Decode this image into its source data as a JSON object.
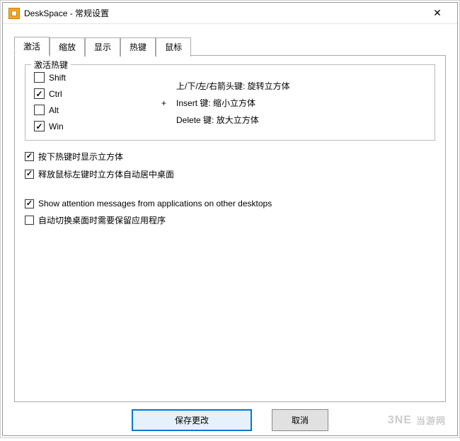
{
  "window": {
    "title": "DeskSpace - 常规设置",
    "close_label": "✕"
  },
  "tabs": {
    "items": [
      {
        "label": "激活",
        "active": true
      },
      {
        "label": "缩放",
        "active": false
      },
      {
        "label": "显示",
        "active": false
      },
      {
        "label": "热键",
        "active": false
      },
      {
        "label": "鼠标",
        "active": false
      }
    ]
  },
  "hotkey_group": {
    "legend": "激活热键",
    "modifiers": [
      {
        "key": "shift",
        "label": "Shift",
        "checked": false
      },
      {
        "key": "ctrl",
        "label": "Ctrl",
        "checked": true
      },
      {
        "key": "alt",
        "label": "Alt",
        "checked": false
      },
      {
        "key": "win",
        "label": "Win",
        "checked": true
      }
    ],
    "plus": "+",
    "hints": [
      "上/下/左/右箭头键: 旋转立方体",
      "Insert 键: 缩小立方体",
      "Delete 键: 放大立方体"
    ]
  },
  "options": [
    {
      "key": "show_cube_on_hotkey",
      "label": "按下热键时显示立方体",
      "checked": true
    },
    {
      "key": "center_on_release",
      "label": "释放鼠标左键时立方体自动居中桌面",
      "checked": true
    },
    {
      "key": "attention_msgs",
      "label": "Show attention messages from applications on other desktops",
      "checked": true
    },
    {
      "key": "keep_apps_on_switch",
      "label": "自动切换桌面时需要保留应用程序",
      "checked": false
    }
  ],
  "buttons": {
    "save": "保存更改",
    "cancel": "取消"
  },
  "watermark": {
    "brand": "3NE",
    "text": "当游网"
  }
}
